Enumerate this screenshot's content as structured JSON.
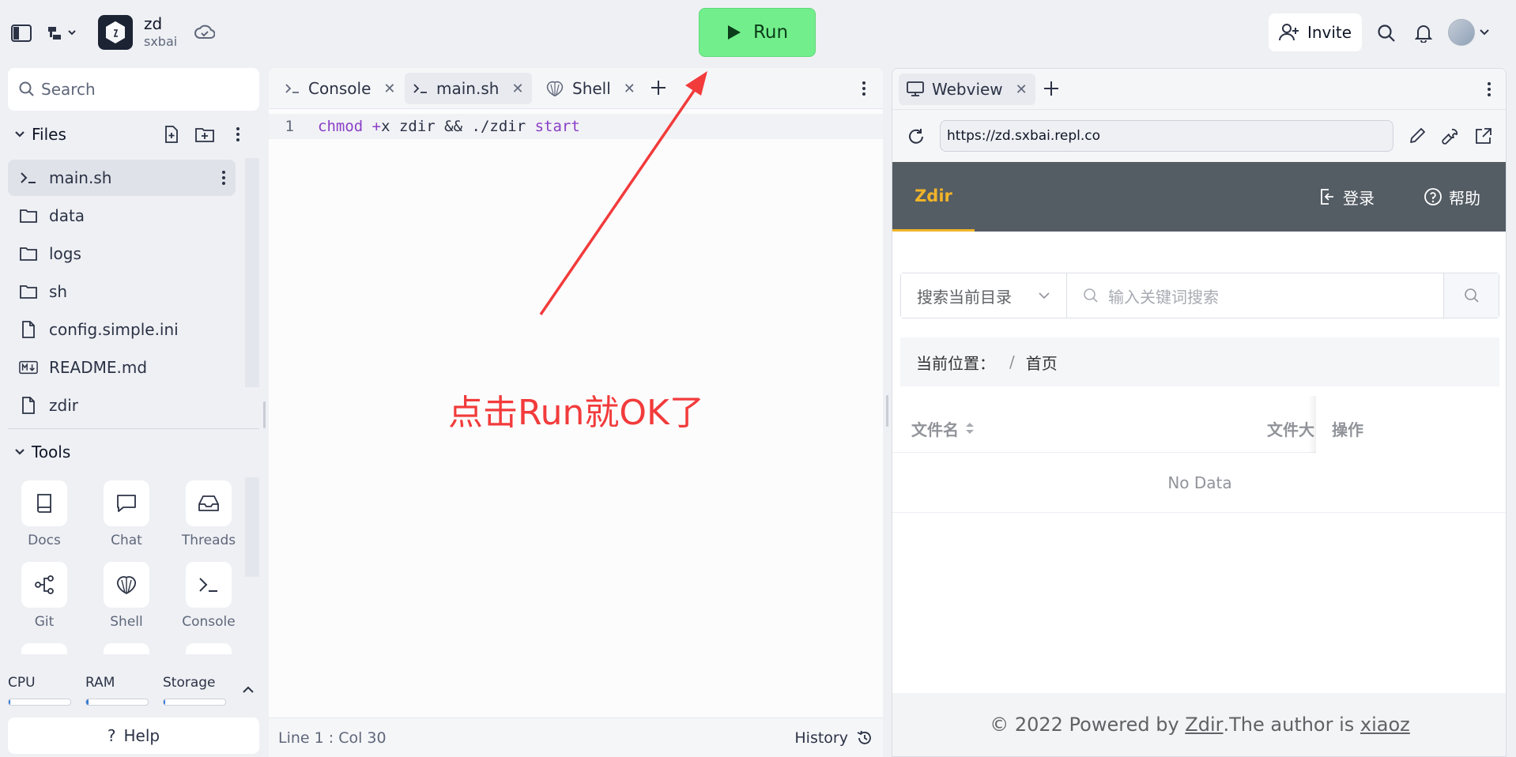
{
  "topbar": {
    "app_name": "zd",
    "app_owner": "sxbai",
    "run_label": "Run",
    "invite_label": "Invite"
  },
  "sidebar": {
    "search_placeholder": "Search",
    "files_heading": "Files",
    "files": [
      {
        "name": "main.sh",
        "icon": "terminal-icon"
      },
      {
        "name": "data",
        "icon": "folder-icon"
      },
      {
        "name": "logs",
        "icon": "folder-icon"
      },
      {
        "name": "sh",
        "icon": "folder-icon"
      },
      {
        "name": "config.simple.ini",
        "icon": "file-icon"
      },
      {
        "name": "README.md",
        "icon": "markdown-icon"
      },
      {
        "name": "zdir",
        "icon": "file-icon"
      }
    ],
    "tools_heading": "Tools",
    "tools": [
      {
        "label": "Docs",
        "icon": "book-icon"
      },
      {
        "label": "Chat",
        "icon": "chat-icon"
      },
      {
        "label": "Threads",
        "icon": "inbox-icon"
      },
      {
        "label": "Git",
        "icon": "git-icon"
      },
      {
        "label": "Shell",
        "icon": "shell-icon"
      },
      {
        "label": "Console",
        "icon": "terminal-icon"
      }
    ],
    "resources": [
      {
        "label": "CPU",
        "usage": 0.02
      },
      {
        "label": "RAM",
        "usage": 0.04
      },
      {
        "label": "Storage",
        "usage": 0.02
      }
    ],
    "help_label": "Help"
  },
  "editor": {
    "tabs": [
      {
        "label": "Console",
        "icon": "terminal-icon"
      },
      {
        "label": "main.sh",
        "icon": "terminal-icon"
      },
      {
        "label": "Shell",
        "icon": "shell-icon"
      }
    ],
    "line_number": "1",
    "code": {
      "t1": "chmod",
      "t2": " ",
      "t3": "+",
      "t4": "x zdir && ./zdir ",
      "t5": "start"
    },
    "status_position": "Line 1 : Col 30",
    "history_label": "History"
  },
  "annotation": {
    "text": "点击Run就OK了",
    "color": "#f23b3b"
  },
  "webview": {
    "tab_label": "Webview",
    "url": "https://zd.sxbai.repl.co",
    "site": {
      "brand": "Zdir",
      "login_label": "登录",
      "help_label": "帮助",
      "search_scope": "搜索当前目录",
      "search_placeholder": "输入关键词搜索",
      "breadcrumb_label": "当前位置：",
      "breadcrumb_sep": "/",
      "breadcrumb_home": "首页",
      "col_name": "文件名",
      "col_size": "文件大",
      "col_actions": "操作",
      "empty_text": "No Data",
      "footer_prefix": "© 2022 Powered by ",
      "footer_link1": "Zdir",
      "footer_mid": ".The author is ",
      "footer_link2": "xiaoz"
    }
  },
  "colors": {
    "run_green": "#73ee8c",
    "brand_yellow": "#f0b428",
    "nav_dark": "#545c64",
    "annotation_red": "#f23b3b"
  }
}
